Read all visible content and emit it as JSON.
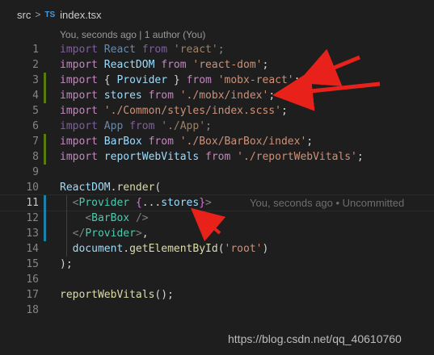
{
  "breadcrumb": {
    "folder": "src",
    "chevron": ">",
    "file_icon": "TS",
    "file": "index.tsx"
  },
  "blame_header": "You, seconds ago | 1 author (You)",
  "lines": [
    {
      "n": "1",
      "tokens": [
        [
          "kw-dim",
          "import "
        ],
        [
          "id-dim",
          "React "
        ],
        [
          "kw-dim",
          "from "
        ],
        [
          "str-dim",
          "'react'"
        ],
        [
          "punc-dim",
          ";"
        ]
      ]
    },
    {
      "n": "2",
      "tokens": [
        [
          "kw",
          "import "
        ],
        [
          "id",
          "ReactDOM "
        ],
        [
          "kw",
          "from "
        ],
        [
          "str",
          "'react-dom'"
        ],
        [
          "punc",
          ";"
        ]
      ]
    },
    {
      "n": "3",
      "tokens": [
        [
          "kw",
          "import "
        ],
        [
          "punc",
          "{ "
        ],
        [
          "id",
          "Provider "
        ],
        [
          "punc",
          "} "
        ],
        [
          "kw",
          "from "
        ],
        [
          "str",
          "'mobx-react'"
        ],
        [
          "punc",
          ";"
        ]
      ]
    },
    {
      "n": "4",
      "tokens": [
        [
          "kw",
          "import "
        ],
        [
          "id",
          "stores "
        ],
        [
          "kw",
          "from "
        ],
        [
          "str",
          "'./mobx/index'"
        ],
        [
          "punc",
          ";"
        ]
      ]
    },
    {
      "n": "5",
      "tokens": [
        [
          "kw",
          "import "
        ],
        [
          "str",
          "'./Common/styles/index.scss'"
        ],
        [
          "punc",
          ";"
        ]
      ]
    },
    {
      "n": "6",
      "tokens": [
        [
          "kw-dim",
          "import "
        ],
        [
          "id-dim",
          "App "
        ],
        [
          "kw-dim",
          "from "
        ],
        [
          "str-dim",
          "'./App'"
        ],
        [
          "punc-dim",
          ";"
        ]
      ]
    },
    {
      "n": "7",
      "tokens": [
        [
          "kw",
          "import "
        ],
        [
          "id",
          "BarBox "
        ],
        [
          "kw",
          "from "
        ],
        [
          "str",
          "'./Box/BarBox/index'"
        ],
        [
          "punc",
          ";"
        ]
      ]
    },
    {
      "n": "8",
      "tokens": [
        [
          "kw",
          "import "
        ],
        [
          "id",
          "reportWebVitals "
        ],
        [
          "kw",
          "from "
        ],
        [
          "str",
          "'./reportWebVitals'"
        ],
        [
          "punc",
          ";"
        ]
      ]
    },
    {
      "n": "9",
      "tokens": []
    },
    {
      "n": "10",
      "tokens": [
        [
          "id",
          "ReactDOM"
        ],
        [
          "punc",
          "."
        ],
        [
          "fn",
          "render"
        ],
        [
          "punc",
          "("
        ]
      ]
    },
    {
      "n": "11",
      "tokens": [
        [
          "punc",
          "  "
        ],
        [
          "tagbr",
          "<"
        ],
        [
          "tag",
          "Provider "
        ],
        [
          "brace",
          "{"
        ],
        [
          "punc",
          "..."
        ],
        [
          "id",
          "stores"
        ],
        [
          "brace",
          "}"
        ],
        [
          "tagbr",
          ">"
        ]
      ]
    },
    {
      "n": "12",
      "tokens": [
        [
          "punc",
          "    "
        ],
        [
          "tagbr",
          "<"
        ],
        [
          "tag",
          "BarBox "
        ],
        [
          "tagbr",
          "/>"
        ]
      ]
    },
    {
      "n": "13",
      "tokens": [
        [
          "punc",
          "  "
        ],
        [
          "tagbr",
          "</"
        ],
        [
          "tag",
          "Provider"
        ],
        [
          "tagbr",
          ">"
        ],
        [
          "punc",
          ","
        ]
      ]
    },
    {
      "n": "14",
      "tokens": [
        [
          "punc",
          "  "
        ],
        [
          "id",
          "document"
        ],
        [
          "punc",
          "."
        ],
        [
          "fn",
          "getElementById"
        ],
        [
          "punc",
          "("
        ],
        [
          "str",
          "'root'"
        ],
        [
          "punc",
          ")"
        ]
      ]
    },
    {
      "n": "15",
      "tokens": [
        [
          "punc",
          ");"
        ]
      ]
    },
    {
      "n": "16",
      "tokens": []
    },
    {
      "n": "17",
      "tokens": [
        [
          "fn",
          "reportWebVitals"
        ],
        [
          "punc",
          "();"
        ]
      ]
    },
    {
      "n": "18",
      "tokens": []
    }
  ],
  "inlay_blame": "You, seconds ago • Uncommitted",
  "watermark": "https://blog.csdn.net/qq_40610760",
  "colors": {
    "added_marker": "#587c0c",
    "modified_marker": "#1b81a8",
    "arrow": "#e8221b"
  }
}
